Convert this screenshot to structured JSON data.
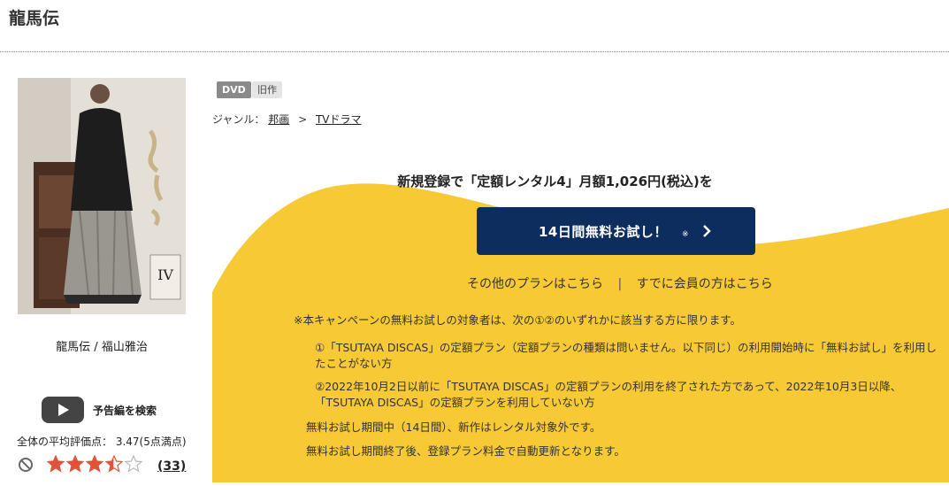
{
  "page": {
    "title": "龍馬伝"
  },
  "product": {
    "cover_alt_text": "IV",
    "caption": "龍馬伝 / 福山雅治",
    "trailer_label": "予告編を検索",
    "rating_label": "全体の平均評価点： 3.47(5点満点)",
    "rating_value": 3.47,
    "rating_max": 5,
    "review_count": "(33)"
  },
  "badges": {
    "format": "DVD",
    "status": "旧作"
  },
  "genre": {
    "prefix": "ジャンル：",
    "level1": "邦画",
    "separator": ">",
    "level2": "TVドラマ"
  },
  "campaign": {
    "headline": "新規登録で「定額レンタル4」月額1,026円(税込)を",
    "trial_button_label": "14日間無料お試し！",
    "trial_button_mark": "※",
    "other_plans_link": "その他のプランはこちら",
    "divider": "|",
    "member_link": "すでに会員の方はこちら",
    "accent_color": "#f7c935",
    "button_color": "#0e2d5f"
  },
  "notes": {
    "main": "※本キャンペーンの無料お試しの対象者は、次の①②のいずれかに該当する方に限ります。",
    "item1": "①「TSUTAYA DISCAS」の定額プラン（定額プランの種類は問いません。以下同じ）の利用開始時に「無料お試し」を利用したことがない方",
    "item2": "②2022年10月2日以前に「TSUTAYA DISCAS」の定額プランの利用を終了された方であって、2022年10月3日以降、「TSUTAYA DISCAS」の定額プランを利用していない方",
    "line3": "無料お試し期間中（14日間）、新作はレンタル対象外です。",
    "line4": "無料お試し期間終了後、登録プラン料金で自動更新となります。"
  }
}
